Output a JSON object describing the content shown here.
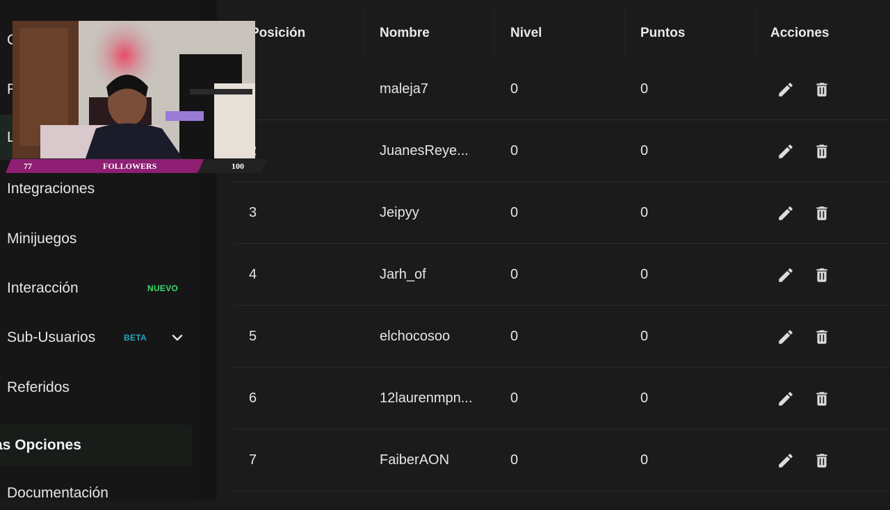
{
  "sidebar": {
    "partial_items": [
      "C",
      "F",
      "L"
    ],
    "items": [
      {
        "label": "Integraciones"
      },
      {
        "label": "Minijuegos"
      },
      {
        "label": "Interacción",
        "badge": "NUEVO"
      },
      {
        "label": "Sub-Usuarios",
        "badge": "BETA"
      },
      {
        "label": "Referidos"
      }
    ],
    "section": "as Opciones",
    "bottom_item": "Documentación"
  },
  "table": {
    "headers": [
      "Posición",
      "Nombre",
      "Nivel",
      "Puntos",
      "Acciones"
    ],
    "rows": [
      {
        "pos": "",
        "name": "maleja7",
        "level": "0",
        "points": "0"
      },
      {
        "pos": "2",
        "name": "JuanesReye...",
        "level": "0",
        "points": "0"
      },
      {
        "pos": "3",
        "name": "Jeipyy",
        "level": "0",
        "points": "0"
      },
      {
        "pos": "4",
        "name": "Jarh_of",
        "level": "0",
        "points": "0"
      },
      {
        "pos": "5",
        "name": "elchocosoo",
        "level": "0",
        "points": "0"
      },
      {
        "pos": "6",
        "name": "12laurenmpn...",
        "level": "0",
        "points": "0"
      },
      {
        "pos": "7",
        "name": "FaiberAON",
        "level": "0",
        "points": "0"
      }
    ],
    "action_icons": [
      "pencil-icon",
      "trash-icon"
    ]
  },
  "overlay": {
    "followers_current": "77",
    "followers_label": "FOLLOWERS",
    "followers_goal": "100"
  },
  "colors": {
    "badge_new": "#3ddc6c",
    "badge_beta": "#2aa5b8",
    "followers_bar": "#8e1f73"
  }
}
